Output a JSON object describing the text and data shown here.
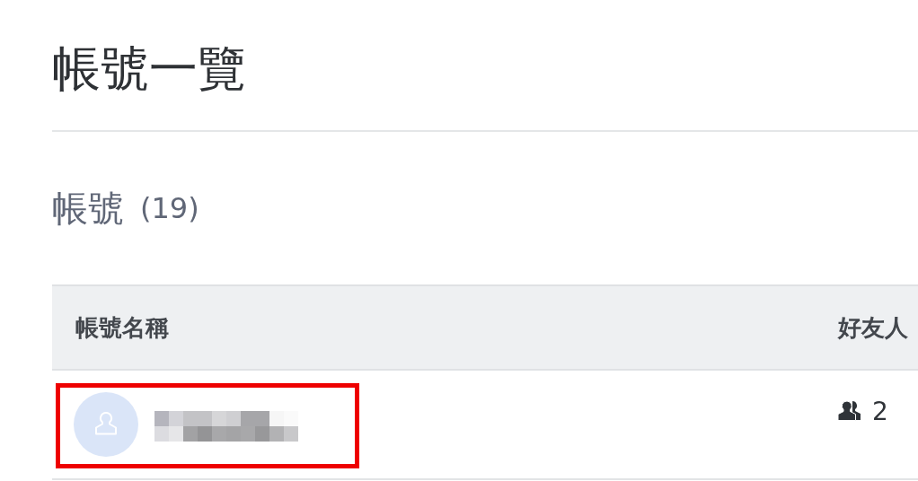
{
  "page_title": "帳號一覽",
  "section": {
    "title": "帳號",
    "count": "(19)"
  },
  "table": {
    "columns": [
      "帳號名稱",
      "好友人"
    ],
    "rows": [
      {
        "friends": "2",
        "highlighted": true
      }
    ]
  }
}
